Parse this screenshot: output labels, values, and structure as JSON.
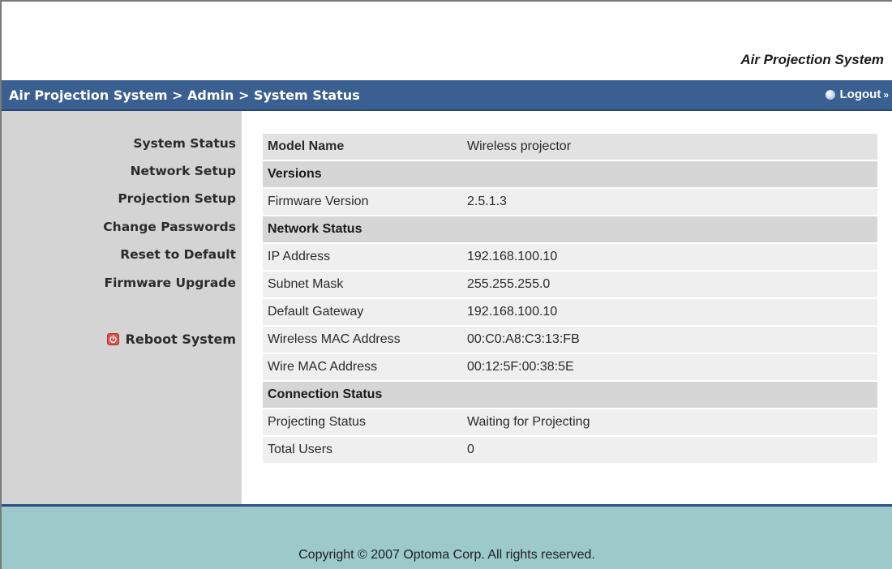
{
  "header": {
    "brand": "Air Projection System",
    "breadcrumb": "Air Projection System > Admin > System Status",
    "logout_label": "Logout",
    "logout_arrow": "»"
  },
  "sidebar": {
    "items": [
      {
        "label": "System Status"
      },
      {
        "label": "Network Setup"
      },
      {
        "label": "Projection Setup"
      },
      {
        "label": "Change Passwords"
      },
      {
        "label": "Reset to Default"
      },
      {
        "label": "Firmware Upgrade"
      }
    ],
    "reboot_label": "Reboot System"
  },
  "status": {
    "model_name_label": "Model Name",
    "model_name_value": "Wireless projector",
    "versions_heading": "Versions",
    "firmware_version_label": "Firmware Version",
    "firmware_version_value": "2.5.1.3",
    "network_status_heading": "Network Status",
    "ip_address_label": "IP Address",
    "ip_address_value": "192.168.100.10",
    "subnet_mask_label": "Subnet Mask",
    "subnet_mask_value": "255.255.255.0",
    "default_gateway_label": "Default Gateway",
    "default_gateway_value": "192.168.100.10",
    "wireless_mac_label": "Wireless MAC Address",
    "wireless_mac_value": "00:C0:A8:C3:13:FB",
    "wire_mac_label": "Wire MAC Address",
    "wire_mac_value": "00:12:5F:00:38:5E",
    "connection_status_heading": "Connection Status",
    "projecting_status_label": "Projecting Status",
    "projecting_status_value": "Waiting for Projecting",
    "total_users_label": "Total Users",
    "total_users_value": "0"
  },
  "footer": {
    "copyright": "Copyright © 2007 Optoma Corp. All rights reserved."
  },
  "colors": {
    "topbar": "#3a5f91",
    "sidebar": "#d4d4d4",
    "footer": "#9ccacb",
    "reboot_icon": "#d9534f"
  },
  "icons": {
    "logout": "globe-icon",
    "reboot": "power-icon"
  }
}
